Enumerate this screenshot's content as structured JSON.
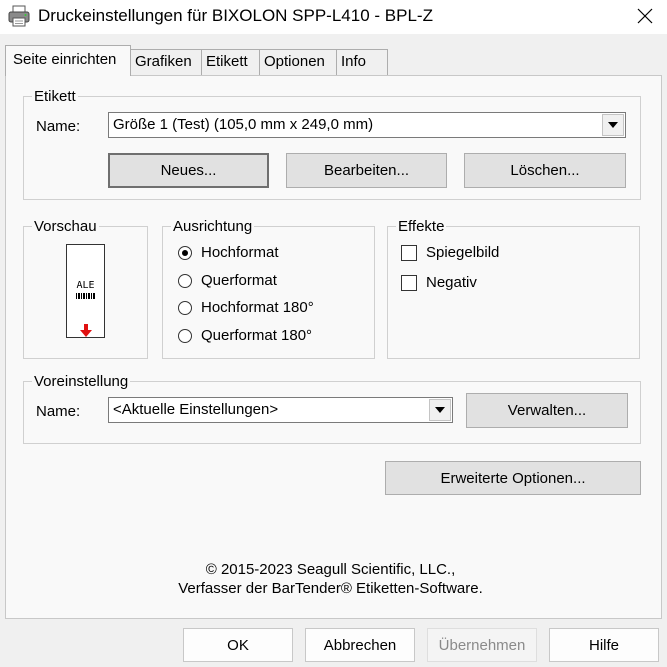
{
  "window": {
    "title": "Druckeinstellungen für BIXOLON SPP-L410 - BPL-Z",
    "close_symbol": "✕"
  },
  "tabs": [
    {
      "label": "Seite einrichten",
      "active": true
    },
    {
      "label": "Grafiken",
      "active": false
    },
    {
      "label": "Etikett",
      "active": false
    },
    {
      "label": "Optionen",
      "active": false
    },
    {
      "label": "Info",
      "active": false
    }
  ],
  "etikett": {
    "legend": "Etikett",
    "name_label": "Name:",
    "name_value": "Größe 1 (Test) (105,0 mm x 249,0 mm)",
    "new_button": "Neues...",
    "edit_button": "Bearbeiten...",
    "delete_button": "Löschen..."
  },
  "vorschau": {
    "legend": "Vorschau",
    "preview_text": "ALE",
    "arrow_color": "#e01010"
  },
  "ausrichtung": {
    "legend": "Ausrichtung",
    "options": [
      {
        "label": "Hochformat",
        "checked": true
      },
      {
        "label": "Querformat",
        "checked": false
      },
      {
        "label": "Hochformat 180°",
        "checked": false
      },
      {
        "label": "Querformat 180°",
        "checked": false
      }
    ]
  },
  "effekte": {
    "legend": "Effekte",
    "options": [
      {
        "label": "Spiegelbild",
        "checked": false
      },
      {
        "label": "Negativ",
        "checked": false
      }
    ]
  },
  "voreinstellung": {
    "legend": "Voreinstellung",
    "name_label": "Name:",
    "name_value": "<Aktuelle Einstellungen>",
    "manage_button": "Verwalten..."
  },
  "advanced_button": "Erweiterte Optionen...",
  "copyright": {
    "line1": "© 2015-2023 Seagull Scientific, LLC.,",
    "line2": "Verfasser der BarTender® Etiketten-Software."
  },
  "footer": {
    "ok": "OK",
    "cancel": "Abbrechen",
    "apply": "Übernehmen",
    "help": "Hilfe"
  }
}
